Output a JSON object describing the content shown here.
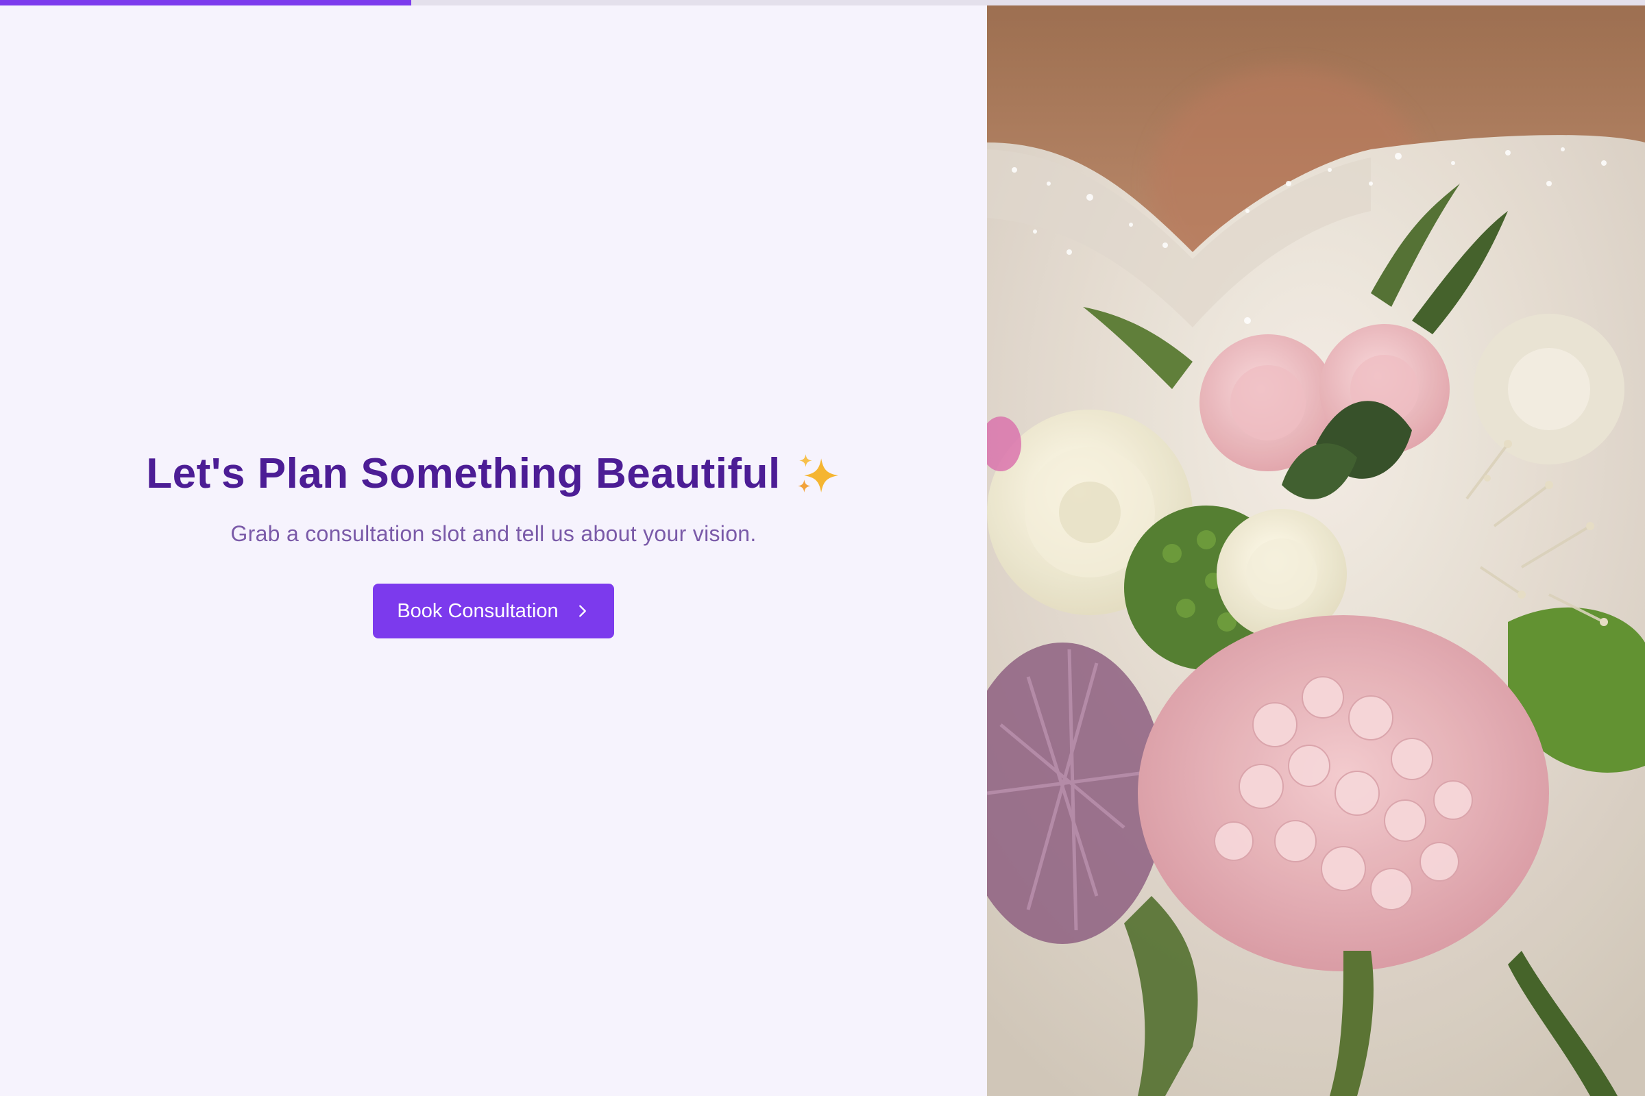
{
  "progress": {
    "fraction": 0.25,
    "color": "#7c3aed"
  },
  "hero": {
    "title": "Let's Plan Something Beautiful",
    "title_icon": "sparkles-icon",
    "subtitle": "Grab a consultation slot and tell us about your vision.",
    "cta_label": "Book Consultation",
    "cta_icon": "chevron-right-icon"
  },
  "colors": {
    "background": "#f6f3fd",
    "title": "#4c1d95",
    "subtitle": "#7a5aa8",
    "accent": "#7c3aed"
  },
  "image": {
    "subject": "bridal-bouquet-photo"
  }
}
